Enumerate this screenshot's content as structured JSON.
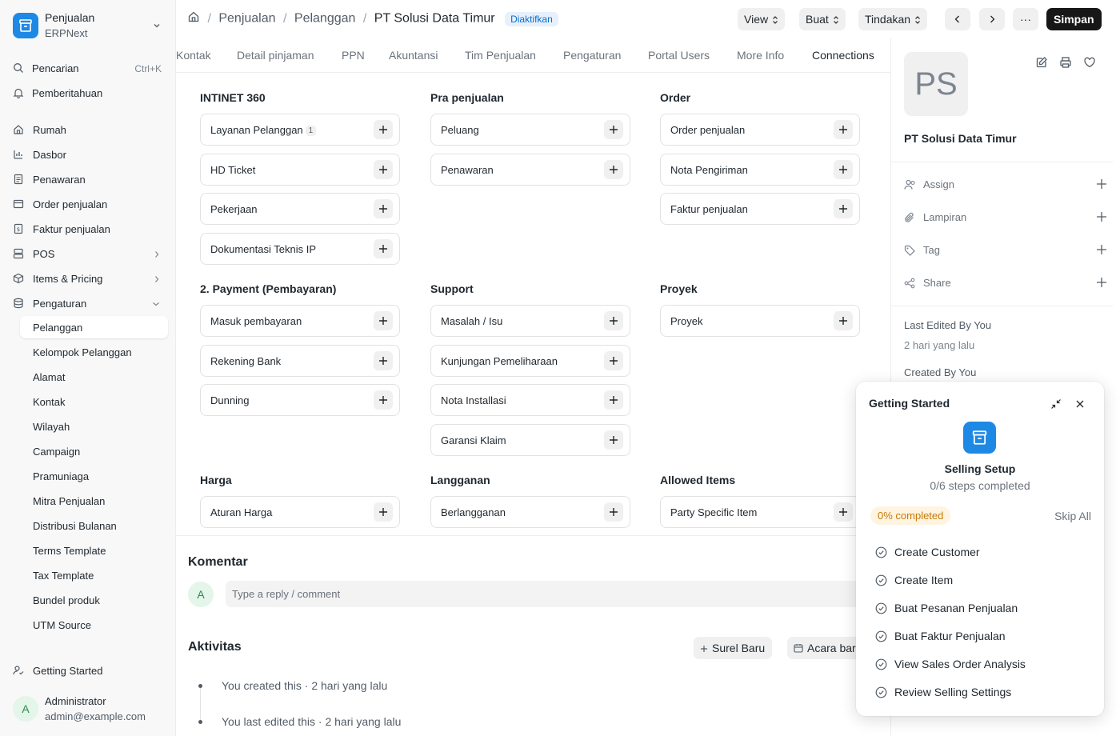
{
  "sidebar": {
    "app_title": "Penjualan",
    "app_subtitle": "ERPNext",
    "search_label": "Pencarian",
    "search_shortcut": "Ctrl+K",
    "notifications_label": "Pemberitahuan",
    "nav": [
      "Rumah",
      "Dasbor",
      "Penawaran",
      "Order penjualan",
      "Faktur penjualan",
      "POS",
      "Items & Pricing",
      "Pengaturan"
    ],
    "sub_items": [
      "Pelanggan",
      "Kelompok Pelanggan",
      "Alamat",
      "Kontak",
      "Wilayah",
      "Campaign",
      "Pramuniaga",
      "Mitra Penjualan",
      "Distribusi Bulanan",
      "Terms Template",
      "Tax Template",
      "Bundel produk",
      "UTM Source"
    ],
    "getting_started": "Getting Started",
    "user_initial": "A",
    "user_name": "Administrator",
    "user_email": "admin@example.com"
  },
  "header": {
    "breadcrumb": [
      "Penjualan",
      "Pelanggan"
    ],
    "title": "PT Solusi Data Timur",
    "status": "Diaktifkan",
    "view_label": "View",
    "create_label": "Buat",
    "actions_label": "Tindakan",
    "more_label": "···",
    "save_label": "Simpan"
  },
  "tabs": [
    "Kontak",
    "Detail pinjaman",
    "PPN",
    "Akuntansi",
    "Tim Penjualan",
    "Pengaturan",
    "Portal Users",
    "More Info",
    "Connections"
  ],
  "connections": {
    "groups": [
      {
        "title": "INTINET 360",
        "items": [
          {
            "label": "Layanan Pelanggan",
            "count": "1"
          },
          {
            "label": "HD Ticket"
          },
          {
            "label": "Pekerjaan"
          },
          {
            "label": "Dokumentasi Teknis IP"
          }
        ]
      },
      {
        "title": "Pra penjualan",
        "items": [
          {
            "label": "Peluang"
          },
          {
            "label": "Penawaran"
          }
        ]
      },
      {
        "title": "Order",
        "items": [
          {
            "label": "Order penjualan"
          },
          {
            "label": "Nota Pengiriman"
          },
          {
            "label": "Faktur penjualan"
          }
        ]
      },
      {
        "title": "2. Payment (Pembayaran)",
        "items": [
          {
            "label": "Masuk pembayaran"
          },
          {
            "label": "Rekening Bank"
          },
          {
            "label": "Dunning"
          }
        ]
      },
      {
        "title": "Support",
        "items": [
          {
            "label": "Masalah / Isu"
          },
          {
            "label": "Kunjungan Pemeliharaan"
          },
          {
            "label": "Nota Installasi"
          },
          {
            "label": "Garansi Klaim"
          }
        ]
      },
      {
        "title": "Proyek",
        "items": [
          {
            "label": "Proyek"
          }
        ]
      },
      {
        "title": "Harga",
        "items": [
          {
            "label": "Aturan Harga"
          }
        ]
      },
      {
        "title": "Langganan",
        "items": [
          {
            "label": "Berlangganan"
          }
        ]
      },
      {
        "title": "Allowed Items",
        "items": [
          {
            "label": "Party Specific Item"
          }
        ]
      }
    ]
  },
  "comments": {
    "title": "Komentar",
    "avatar": "A",
    "placeholder": "Type a reply / comment"
  },
  "activity": {
    "title": "Aktivitas",
    "new_email": "Surel Baru",
    "new_event": "Acara baru",
    "items": [
      "You created this · 2 hari yang lalu",
      "You last edited this · 2 hari yang lalu"
    ]
  },
  "right_panel": {
    "initials": "PS",
    "name": "PT Solusi Data Timur",
    "rows": [
      "Assign",
      "Lampiran",
      "Tag",
      "Share"
    ],
    "last_edited_label": "Last Edited By You",
    "last_edited_time": "2 hari yang lalu",
    "created_label": "Created By You"
  },
  "getting_started": {
    "title": "Getting Started",
    "heading": "Selling Setup",
    "steps_text": "0/6 steps completed",
    "progress_label": "0% completed",
    "progress": 0,
    "skip_label": "Skip All",
    "items": [
      "Create Customer",
      "Create Item",
      "Buat Pesanan Penjualan",
      "Buat Faktur Penjualan",
      "View Sales Order Analysis",
      "Review Selling Settings"
    ]
  }
}
